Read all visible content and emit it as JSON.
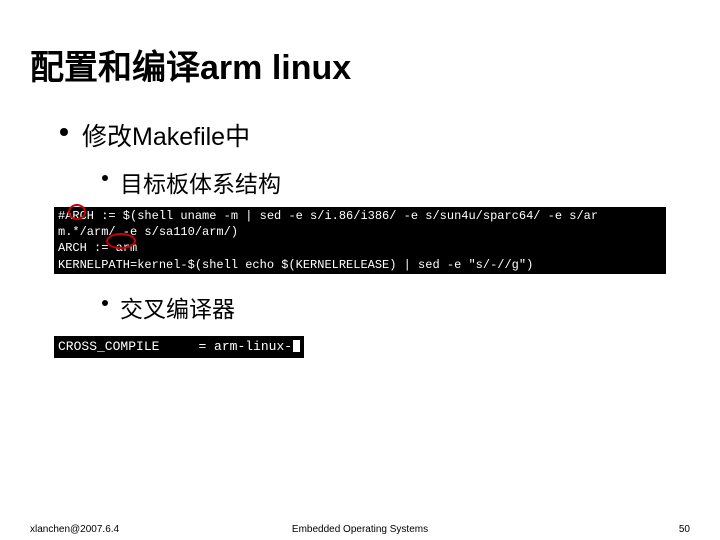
{
  "title": "配置和编译arm linux",
  "bullets": {
    "l1": "修改Makefile中",
    "l2a": "目标板体系结构",
    "l2b": "交叉编译器"
  },
  "code1": {
    "line1": "#ARCH := $(shell uname -m | sed -e s/i.86/i386/ -e s/sun4u/sparc64/ -e s/ar",
    "line2": "m.*/arm/ -e s/sa110/arm/)",
    "line3": "ARCH := arm",
    "line4": "KERNELPATH=kernel-$(shell echo $(KERNELRELEASE) | sed -e \"s/-//g\")"
  },
  "code2": {
    "line1_a": "CROSS_COMPILE",
    "line1_b": "= arm-linux-"
  },
  "footer": {
    "left": "xlanchen@2007.6.4",
    "center": "Embedded Operating Systems",
    "right": "50"
  }
}
